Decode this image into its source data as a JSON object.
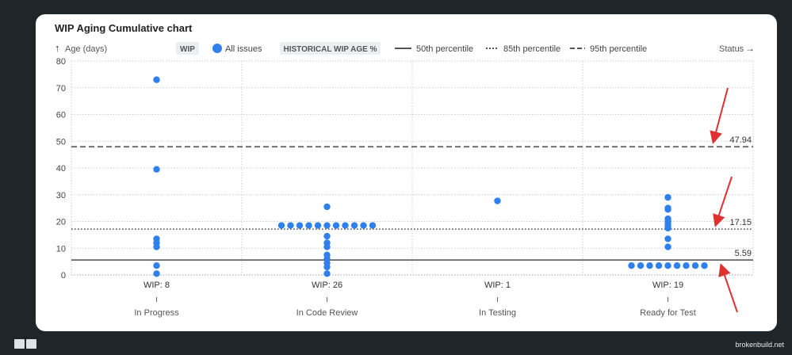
{
  "card": {
    "title": "WIP Aging Cumulative chart"
  },
  "footer": {
    "site": "brokenbuild.net"
  },
  "legend": {
    "y_axis_label": "Age (days)",
    "wip_badge": "WIP",
    "all_issues": "All issues",
    "historical_badge": "HISTORICAL WIP AGE %",
    "p50": "50th percentile",
    "p85": "85th percentile",
    "p95": "95th percentile",
    "status_label": "Status"
  },
  "colors": {
    "point": "#2f80ed",
    "line": "#666666",
    "arrow": "#e03030"
  },
  "chart_data": {
    "type": "scatter",
    "ylim": [
      0,
      80
    ],
    "yticks": [
      "0",
      "10",
      "20",
      "30",
      "40",
      "50",
      "60",
      "70",
      "80"
    ],
    "categories": [
      "In Progress",
      "In Code Review",
      "In Testing",
      "Ready for Test"
    ],
    "wip_labels": [
      "WIP: 8",
      "WIP: 26",
      "WIP: 1",
      "WIP: 19"
    ],
    "percentiles": [
      {
        "label": "5.59",
        "value": 5.59,
        "style": "solid"
      },
      {
        "label": "17.15",
        "value": 17.15,
        "style": "dotted"
      },
      {
        "label": "47.94",
        "value": 47.94,
        "style": "dashed"
      }
    ],
    "points": [
      [
        {
          "y": 73
        },
        {
          "y": 39.5
        },
        {
          "y": 13.5
        },
        {
          "y": 12
        },
        {
          "y": 10.5
        },
        {
          "y": 3.5
        },
        {
          "y": 0.5
        }
      ],
      [
        {
          "y": 25.5
        },
        {
          "y": 18.5,
          "group": 11
        },
        {
          "y": 14.5
        },
        {
          "y": 12
        },
        {
          "y": 10.5
        },
        {
          "y": 7.5
        },
        {
          "y": 6
        },
        {
          "y": 4.5
        },
        {
          "y": 3
        },
        {
          "y": 0.5
        }
      ],
      [
        {
          "y": 27.7
        }
      ],
      [
        {
          "y": 29
        },
        {
          "y": 25
        },
        {
          "y": 24.5
        },
        {
          "y": 21
        },
        {
          "y": 20
        },
        {
          "y": 19
        },
        {
          "y": 18
        },
        {
          "y": 17.5
        },
        {
          "y": 13.5
        },
        {
          "y": 10.5
        },
        {
          "y": 3.5,
          "group": 9
        }
      ]
    ]
  }
}
